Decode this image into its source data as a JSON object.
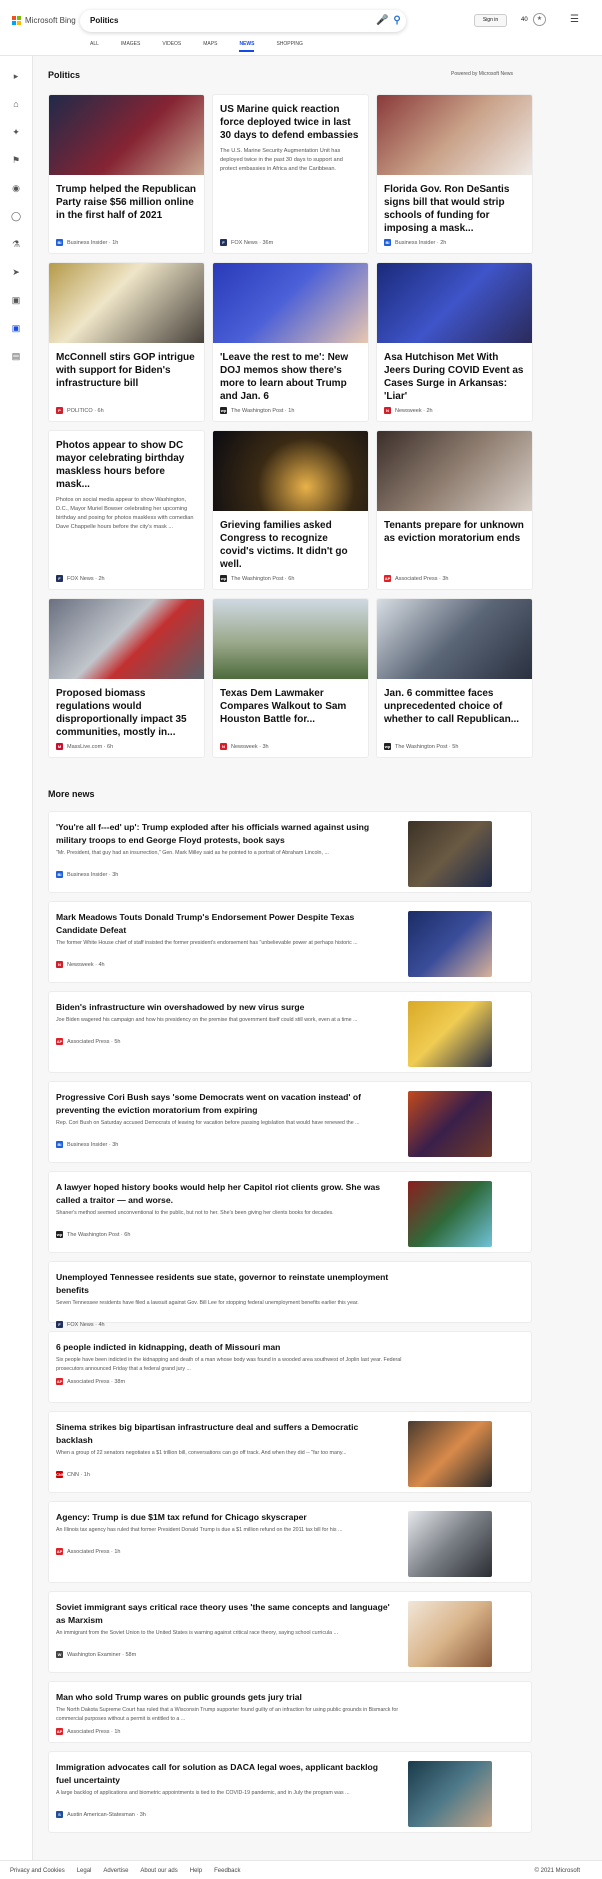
{
  "header": {
    "brand": "Microsoft Bing",
    "search_value": "Politics",
    "tabs": [
      "ALL",
      "IMAGES",
      "VIDEOS",
      "MAPS",
      "NEWS",
      "SHOPPING"
    ],
    "active_tab": "NEWS",
    "signin": "Sign in",
    "points": "40",
    "icons": {
      "mic": "mic-icon",
      "search": "search-icon",
      "reward": "rewards-icon",
      "menu": "menu-icon"
    }
  },
  "page": {
    "title": "Politics",
    "powered": "Powered by Microsoft News",
    "more_news": "More news"
  },
  "colors": {
    "accent": "#174ae4",
    "background": "#f7f7f7"
  },
  "cards": [
    {
      "title": "Trump helped the Republican Party raise $56 million online in the first half of 2021",
      "desc": "",
      "source": "Business Insider · 1h",
      "badge": "BI",
      "badge_color": "#1f5fd9",
      "img": "linear-gradient(135deg,#1f2a4a,#862433 55%,#c8a892)"
    },
    {
      "title": "US Marine quick reaction force deployed twice in last 30 days to defend embassies",
      "desc": "The U.S. Marine Security Augmentation Unit has deployed twice in the past 30 days to support and protect embassies in Africa and the Caribbean.",
      "source": "FOX News · 36m",
      "badge": "F",
      "badge_color": "#20315d",
      "img": ""
    },
    {
      "title": "Florida Gov. Ron DeSantis signs bill that would strip schools of funding for imposing a mask...",
      "desc": "",
      "source": "Business Insider · 2h",
      "badge": "BI",
      "badge_color": "#1f5fd9",
      "img": "linear-gradient(135deg,#8a3a3a,#c9a188 50%,#efeae6)"
    },
    {
      "title": "McConnell stirs GOP intrigue with support for Biden's infrastructure bill",
      "desc": "",
      "source": "POLITICO · 6h",
      "badge": "P",
      "badge_color": "#d02030",
      "img": "linear-gradient(135deg,#b59a4a,#efe5c8 40%,#47413b)"
    },
    {
      "title": "'Leave the rest to me': New DOJ memos show there's more to learn about Trump and Jan. 6",
      "desc": "",
      "source": "The Washington Post · 1h",
      "badge": "wp",
      "badge_color": "#222",
      "img": "linear-gradient(135deg,#2a3ab8,#4a5fd8 45%,#e8c7b0)"
    },
    {
      "title": "Asa Hutchison Met With Jeers During COVID Event as Cases Surge in Arkansas: 'Liar'",
      "desc": "",
      "source": "Newsweek · 2h",
      "badge": "N",
      "badge_color": "#d0202c",
      "img": "linear-gradient(135deg,#1a2a7a,#3f54c8 50%,#2a2a5a)"
    },
    {
      "title": "Photos appear to show DC mayor celebrating birthday maskless hours before mask...",
      "desc": "Photos on social media appear to show Washington, D.C., Mayor Muriel Bowser celebrating her upcoming birthday and posing for photos maskless with comedian Dave Chappelle hours before the city's mask ...",
      "source": "FOX News · 2h",
      "badge": "F",
      "badge_color": "#20315d",
      "img": ""
    },
    {
      "title": "Grieving families asked Congress to recognize covid's victims. It didn't go well.",
      "desc": "",
      "source": "The Washington Post · 6h",
      "badge": "wp",
      "badge_color": "#222",
      "img": "radial-gradient(circle at 60% 70%,#e9b24a,#3a2a14 45%,#0b0b12)"
    },
    {
      "title": "Tenants prepare for unknown as eviction moratorium ends",
      "desc": "",
      "source": "Associated Press · 3h",
      "badge": "AP",
      "badge_color": "#e01f26",
      "img": "linear-gradient(135deg,#3b2f2a,#8f7d70 50%,#d9d0c8)"
    },
    {
      "title": "Proposed biomass regulations would disproportionally impact 35 communities, mostly in...",
      "desc": "",
      "source": "MassLive.com · 6h",
      "badge": "M",
      "badge_color": "#c8102e",
      "img": "linear-gradient(135deg,#6a7080,#c1c6cc 45%,#c23030 60%,#5a6068)"
    },
    {
      "title": "Texas Dem Lawmaker Compares Walkout to Sam Houston Battle for...",
      "desc": "",
      "source": "Newsweek · 3h",
      "badge": "N",
      "badge_color": "#d0202c",
      "img": "linear-gradient(180deg,#cfd9e3,#9aa88a 55%,#4d6b3c)"
    },
    {
      "title": "Jan. 6 committee faces unprecedented choice of whether to call Republican...",
      "desc": "",
      "source": "The Washington Post · 5h",
      "badge": "wp",
      "badge_color": "#222",
      "img": "linear-gradient(135deg,#d8dde3,#5b6677 50%,#2a3140)"
    }
  ],
  "more": [
    {
      "title": "'You're all f---ed' up': Trump exploded after his officials warned against using military troops to end George Floyd protests, book says",
      "desc": "\"Mr. President, that guy had an insurrection,\" Gen. Mark Milley said as he pointed to a portrait of Abraham Lincoln, ...",
      "source": "Business Insider · 3h",
      "badge": "BI",
      "badge_color": "#1f5fd9",
      "img": "linear-gradient(135deg,#3b3226,#6a5a44 50%,#1f2a4a)"
    },
    {
      "title": "Mark Meadows Touts Donald Trump's Endorsement Power Despite Texas Candidate Defeat",
      "desc": "The former White House chief of staff insisted the former president's endorsement has \"unbelievable power at perhaps historic ...",
      "source": "Newsweek · 4h",
      "badge": "N",
      "badge_color": "#d0202c",
      "img": "linear-gradient(135deg,#1c2c66,#3a4d9a 50%,#d9b39a)"
    },
    {
      "title": "Biden's infrastructure win overshadowed by new virus surge",
      "desc": "Joe Biden wagered his campaign and how his presidency on the premise that government itself could still work, even at a time ...",
      "source": "Associated Press · 5h",
      "badge": "AP",
      "badge_color": "#e01f26",
      "img": "linear-gradient(135deg,#d9a928,#f0cc52 45%,#2a2f45)"
    },
    {
      "title": "Progressive Cori Bush says 'some Democrats went on vacation instead' of preventing the eviction moratorium from expiring",
      "desc": "Rep. Cori Bush on Saturday accused Democrats of leaving for vacation before passing legislation that would have renewed the ...",
      "source": "Business Insider · 3h",
      "badge": "BI",
      "badge_color": "#1f5fd9",
      "img": "linear-gradient(135deg,#c24a1c,#3a1f4a 50%,#6d3a2a)"
    },
    {
      "title": "A lawyer hoped history books would help her Capitol riot clients grow. She was called a traitor — and worse.",
      "desc": "Shaner's method seemed unconventional to the public, but not to her. She's been giving her clients books for decades.",
      "source": "The Washington Post · 6h",
      "badge": "wp",
      "badge_color": "#222",
      "img": "linear-gradient(135deg,#8a1f1f,#2f6a3a 50%,#6fc2d9)"
    },
    {
      "title": "Unemployed Tennessee residents sue state, governor to reinstate unemployment benefits",
      "desc": "Seven Tennessee residents have filed a lawsuit against Gov. Bill Lee for stopping federal unemployment benefits earlier this year.",
      "source": "FOX News · 4h",
      "badge": "F",
      "badge_color": "#20315d",
      "img": ""
    },
    {
      "title": "6 people indicted in kidnapping, death of Missouri man",
      "desc": "Six people have been indicted in the kidnapping and death of a man whose body was found in a wooded area southwest of Joplin last year. Federal prosecutors announced Friday that a federal grand jury ...",
      "source": "Associated Press · 38m",
      "badge": "AP",
      "badge_color": "#e01f26",
      "img": ""
    },
    {
      "title": "Sinema strikes big bipartisan infrastructure deal and suffers a Democratic backlash",
      "desc": "When a group of 22 senators negotiates a $1 trillion bill, conversations can go off track. And when they did -- \"far too many...",
      "source": "CNN · 1h",
      "badge": "CNN",
      "badge_color": "#cc0000",
      "img": "linear-gradient(135deg,#4a3b30,#d98a4a 50%,#2a2a2a)"
    },
    {
      "title": "Agency: Trump is due $1M tax refund for Chicago skyscraper",
      "desc": "An Illinois tax agency has ruled that former President Donald Trump is due a $1 million refund on the 2011 tax bill for his ...",
      "source": "Associated Press · 1h",
      "badge": "AP",
      "badge_color": "#e01f26",
      "img": "linear-gradient(135deg,#e6e8eb,#7a7f86 50%,#2b2e33)"
    },
    {
      "title": "Soviet immigrant says critical race theory uses 'the same concepts and language' as Marxism",
      "desc": "An immigrant from the Soviet Union to the United States is warning against critical race theory, saying school curricula ...",
      "source": "Washington Examiner · 58m",
      "badge": "W",
      "badge_color": "#444",
      "img": "linear-gradient(135deg,#f1e6d8,#d9b48a 50%,#8a5a3a)"
    },
    {
      "title": "Man who sold Trump wares on public grounds gets jury trial",
      "desc": "The North Dakota Supreme Court has ruled that a Wisconsin Trump supporter found guilty of an infraction for using public grounds in Bismarck for commercial purposes without a permit is entitled to a ...",
      "source": "Associated Press · 1h",
      "badge": "AP",
      "badge_color": "#e01f26",
      "img": ""
    },
    {
      "title": "Immigration advocates call for solution as DACA legal woes, applicant backlog fuel uncertainty",
      "desc": "A large backlog of applications and biometric appointments is tied to the COVID-19 pandemic, and in July the program was ...",
      "source": "Austin American-Statesman · 3h",
      "badge": "S",
      "badge_color": "#1f4e9a",
      "img": "linear-gradient(135deg,#1a3a4a,#4f7a8a 50%,#c9a78a)"
    }
  ],
  "footer": {
    "links": [
      "Privacy and Cookies",
      "Legal",
      "Advertise",
      "About our ads",
      "Help",
      "Feedback"
    ],
    "copyright": "© 2021 Microsoft"
  }
}
